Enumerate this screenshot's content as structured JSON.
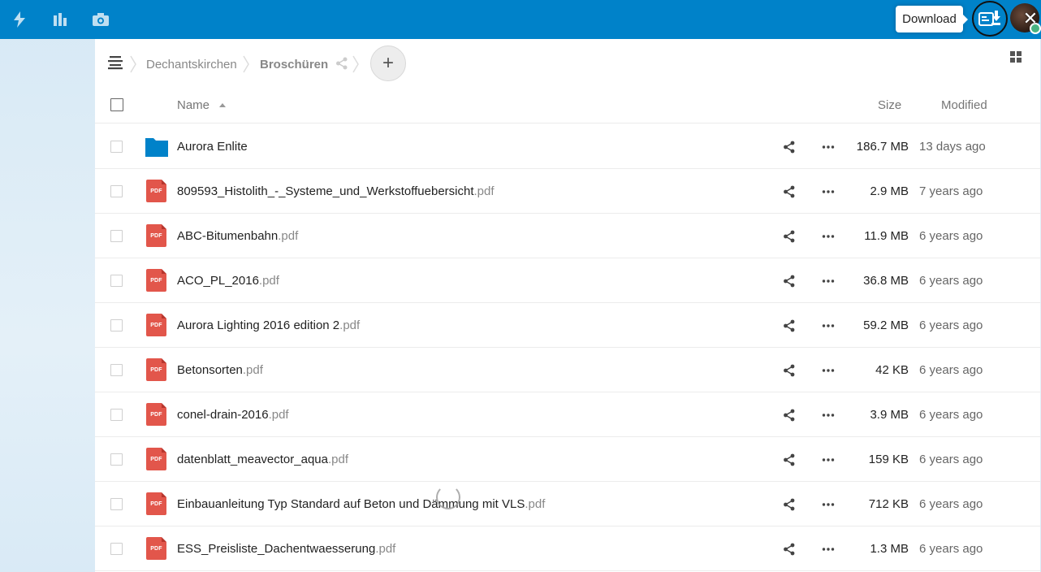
{
  "header": {
    "apps": [
      {
        "icon": "activity-icon",
        "name": "Activity"
      },
      {
        "icon": "dashboard-icon",
        "name": "Dashboard"
      },
      {
        "icon": "photos-icon",
        "name": "Photos"
      }
    ],
    "tooltip": "Download",
    "brand_color": "#0082c9"
  },
  "breadcrumb": {
    "items": [
      "Dechantskirchen",
      "Broschüren"
    ]
  },
  "add_button_label": "+",
  "table": {
    "headers": {
      "name": "Name",
      "size": "Size",
      "modified": "Modified"
    },
    "sort": "name-ascending",
    "rows": [
      {
        "type": "folder",
        "name": "Aurora Enlite",
        "ext": "",
        "size": "186.7 MB",
        "modified": "13 days ago"
      },
      {
        "type": "pdf",
        "name": "809593_Histolith_-_Systeme_und_Werkstoffuebersicht",
        "ext": ".pdf",
        "size": "2.9 MB",
        "modified": "7 years ago"
      },
      {
        "type": "pdf",
        "name": "ABC-Bitumenbahn",
        "ext": ".pdf",
        "size": "11.9 MB",
        "modified": "6 years ago"
      },
      {
        "type": "pdf",
        "name": "ACO_PL_2016",
        "ext": ".pdf",
        "size": "36.8 MB",
        "modified": "6 years ago"
      },
      {
        "type": "pdf",
        "name": "Aurora Lighting 2016 edition 2",
        "ext": ".pdf",
        "size": "59.2 MB",
        "modified": "6 years ago"
      },
      {
        "type": "pdf",
        "name": "Betonsorten",
        "ext": ".pdf",
        "size": "42 KB",
        "modified": "6 years ago"
      },
      {
        "type": "pdf",
        "name": "conel-drain-2016",
        "ext": ".pdf",
        "size": "3.9 MB",
        "modified": "6 years ago"
      },
      {
        "type": "pdf",
        "name": "datenblatt_meavector_aqua",
        "ext": ".pdf",
        "size": "159 KB",
        "modified": "6 years ago"
      },
      {
        "type": "pdf",
        "name": "Einbauanleitung Typ Standard auf Beton und Dämmung mit VLS",
        "ext": ".pdf",
        "size": "712 KB",
        "modified": "6 years ago"
      },
      {
        "type": "pdf",
        "name": "ESS_Preisliste_Dachentwaesserung",
        "ext": ".pdf",
        "size": "1.3 MB",
        "modified": "6 years ago"
      }
    ]
  },
  "pdf_label": "PDF",
  "colors": {
    "folder": "#0082c9",
    "pdf": "#e2564b"
  }
}
